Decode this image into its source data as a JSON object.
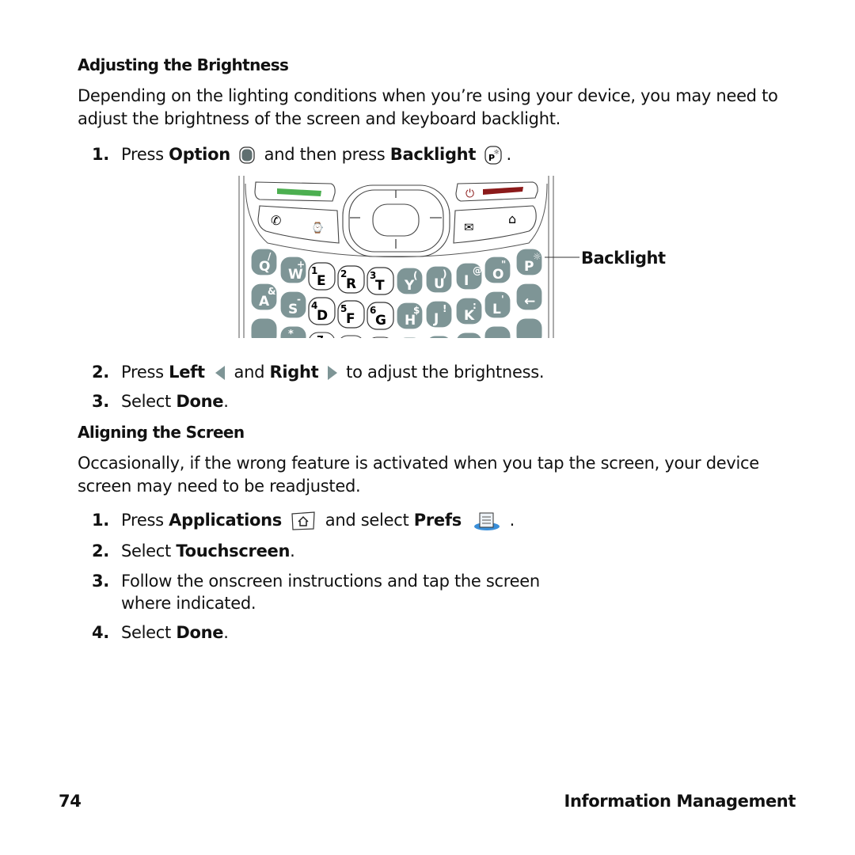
{
  "section1": {
    "heading": "Adjusting the Brightness",
    "intro": "Depending on the lighting conditions when you’re using your device, you may need to adjust the brightness of the screen and keyboard backlight.",
    "steps": [
      {
        "num": "1.",
        "a": "Press ",
        "b": "Option",
        "c": " and then press ",
        "d": "Backlight",
        "e": "."
      },
      {
        "num": "2.",
        "a": "Press ",
        "b": "Left",
        "c": " and ",
        "d": "Right",
        "e": " to adjust the brightness."
      },
      {
        "num": "3.",
        "a": "Select ",
        "b": "Done",
        "c": "."
      }
    ],
    "callout": "Backlight"
  },
  "keyboard": {
    "row1": [
      "Q",
      "W",
      "E",
      "R",
      "T",
      "Y",
      "U",
      "I",
      "O",
      "P"
    ],
    "row1_alt": [
      "/",
      "+",
      "1",
      "2",
      "3",
      "(",
      ")",
      "@",
      "\"",
      "☼"
    ],
    "row2": [
      "A",
      "S",
      "D",
      "F",
      "G",
      "H",
      "J",
      "K",
      "L",
      "←"
    ],
    "row2_alt": [
      "&",
      "-",
      "4",
      "5",
      "6",
      "$",
      "!",
      ":",
      "'",
      ""
    ],
    "row3_alt": [
      "",
      "*",
      "7"
    ],
    "key_color": "#7e9596",
    "send_color": "#4caf50",
    "end_color": "#8b1a1a"
  },
  "section2": {
    "heading": "Aligning the Screen",
    "intro": "Occasionally, if the wrong feature is activated when you tap the screen, your device screen may need to be readjusted.",
    "steps": [
      {
        "num": "1.",
        "a": "Press ",
        "b": "Applications",
        "c": " and select ",
        "d": "Prefs",
        "e": " ."
      },
      {
        "num": "2.",
        "a": "Select ",
        "b": "Touchscreen",
        "c": "."
      },
      {
        "num": "3.",
        "a": "Follow the onscreen instructions and tap the screen",
        "c2": "where indicated."
      },
      {
        "num": "4.",
        "a": "Select ",
        "b": "Done",
        "c": "."
      }
    ]
  },
  "footer": {
    "page_number": "74",
    "chapter": "Information Management"
  }
}
